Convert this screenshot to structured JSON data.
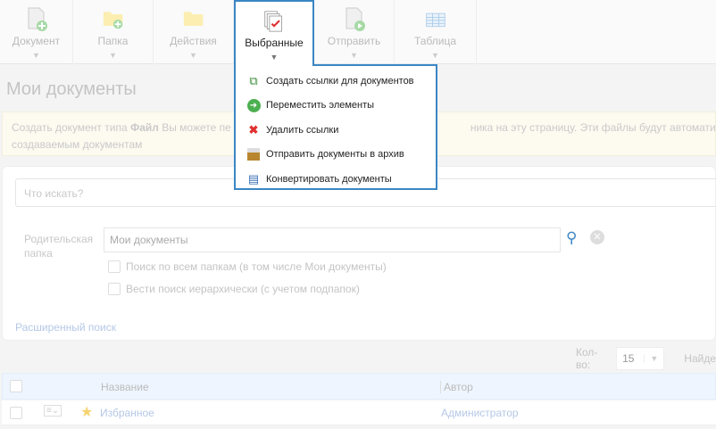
{
  "toolbar": [
    {
      "label": "Документ"
    },
    {
      "label": "Папка"
    },
    {
      "label": "Действия"
    },
    {
      "label": "Выбранные"
    },
    {
      "label": "Отправить"
    },
    {
      "label": "Таблица"
    }
  ],
  "menu": [
    {
      "label": "Создать ссылки для документов",
      "icon": "create-links-icon"
    },
    {
      "label": "Переместить элементы",
      "icon": "move-icon"
    },
    {
      "label": "Удалить ссылки",
      "icon": "delete-icon"
    },
    {
      "label": "Отправить документы в архив",
      "icon": "archive-icon"
    },
    {
      "label": "Конвертировать документы",
      "icon": "convert-icon"
    }
  ],
  "page_title": "Мои документы",
  "notice": {
    "pre": "Создать документ типа ",
    "bold": "Файл",
    "mid": " Вы можете пе",
    "post": "ника на эту страницу. Эти файлы будут автоматически з",
    "line2": "создаваемым документам"
  },
  "search": {
    "placeholder": "Что искать?",
    "parent_label": "Родительская папка",
    "parent_value": "Мои документы",
    "opt1": "Поиск по всем папкам (в том числе Мои документы)",
    "opt2": "Вести поиск иерархически (с учетом подпапок)",
    "advanced": "Расширенный поиск"
  },
  "pager": {
    "qty_label": "Кол-во:",
    "qty": "15",
    "found": "Найде"
  },
  "table": {
    "col_name": "Название",
    "col_author": "Автор",
    "rows": [
      {
        "name": "Избранное",
        "author": "Администратор"
      }
    ]
  }
}
